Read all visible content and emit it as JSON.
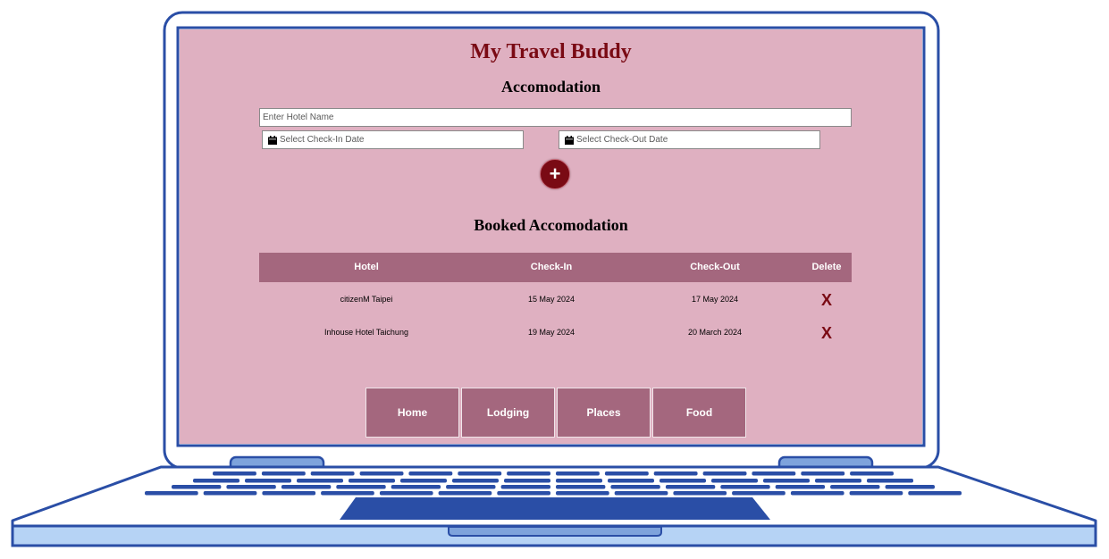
{
  "app": {
    "title": "My Travel Buddy"
  },
  "form": {
    "heading": "Accomodation",
    "hotel_placeholder": "Enter Hotel Name",
    "checkin_placeholder": "Select Check-In Date",
    "checkout_placeholder": "Select Check-Out Date",
    "add_label": "+"
  },
  "booked": {
    "heading": "Booked Accomodation",
    "columns": [
      "Hotel",
      "Check-In",
      "Check-Out",
      "Delete"
    ],
    "rows": [
      {
        "hotel": "citizenM Taipei",
        "check_in": "15 May 2024",
        "check_out": "17 May 2024",
        "delete": "X"
      },
      {
        "hotel": "Inhouse Hotel Taichung",
        "check_in": "19 May 2024",
        "check_out": "20 March 2024",
        "delete": "X"
      }
    ]
  },
  "nav": {
    "items": [
      "Home",
      "Lodging",
      "Places",
      "Food"
    ]
  },
  "colors": {
    "screen_bg": "#dfb0c1",
    "accent": "#7a0a14",
    "table_header": "#a4677e",
    "laptop_outline": "#2a4ea6"
  },
  "icons": [
    "calendar-icon",
    "plus-icon",
    "delete-x-icon"
  ]
}
